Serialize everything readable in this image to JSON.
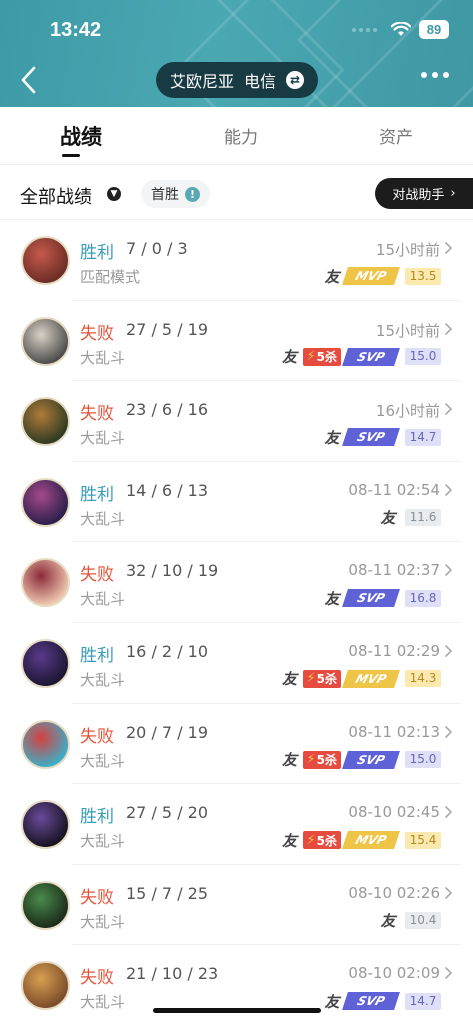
{
  "status_bar": {
    "time": "13:42",
    "battery": "89"
  },
  "header": {
    "server_name": "艾欧尼亚",
    "server_isp": "电信"
  },
  "tabs": [
    {
      "label": "战绩",
      "active": true
    },
    {
      "label": "能力",
      "active": false
    },
    {
      "label": "资产",
      "active": false
    }
  ],
  "filter": {
    "label": "全部战绩",
    "first_win_label": "首胜",
    "assist_label": "对战助手"
  },
  "colors": {
    "win": "#3a9db6",
    "loss": "#e3553a",
    "header": "#4aa8b3"
  },
  "matches": [
    {
      "result": "胜利",
      "outcome": "win",
      "kda": "7 / 0 / 3",
      "mode": "匹配模式",
      "time": "15小时前",
      "friend": true,
      "five_kill": false,
      "award": "mvp",
      "score": "13.5",
      "score_style": "gold",
      "avatar": [
        "#c45a4a",
        "#6b2c25"
      ]
    },
    {
      "result": "失败",
      "outcome": "loss",
      "kda": "27 / 5 / 19",
      "mode": "大乱斗",
      "time": "15小时前",
      "friend": true,
      "five_kill": true,
      "award": "svp",
      "score": "15.0",
      "score_style": "purple",
      "avatar": [
        "#d9d2c5",
        "#4a4a4a"
      ]
    },
    {
      "result": "失败",
      "outcome": "loss",
      "kda": "23 / 6 / 16",
      "mode": "大乱斗",
      "time": "16小时前",
      "friend": true,
      "five_kill": false,
      "award": "svp",
      "score": "14.7",
      "score_style": "purple",
      "avatar": [
        "#b07b3a",
        "#2d3a22"
      ]
    },
    {
      "result": "胜利",
      "outcome": "win",
      "kda": "14 / 6 / 13",
      "mode": "大乱斗",
      "time": "08-11 02:54",
      "friend": true,
      "five_kill": false,
      "award": "",
      "score": "11.6",
      "score_style": "gray",
      "avatar": [
        "#a34a8a",
        "#2a1e4a"
      ]
    },
    {
      "result": "失败",
      "outcome": "loss",
      "kda": "32 / 10 / 19",
      "mode": "大乱斗",
      "time": "08-11 02:37",
      "friend": true,
      "five_kill": false,
      "award": "svp",
      "score": "16.8",
      "score_style": "purple",
      "avatar": [
        "#8a2a3a",
        "#f0c9b0"
      ]
    },
    {
      "result": "胜利",
      "outcome": "win",
      "kda": "16 / 2 / 10",
      "mode": "大乱斗",
      "time": "08-11 02:29",
      "friend": true,
      "five_kill": true,
      "award": "mvp",
      "score": "14.3",
      "score_style": "gold",
      "avatar": [
        "#5a3a8a",
        "#1a1530"
      ]
    },
    {
      "result": "失败",
      "outcome": "loss",
      "kda": "20 / 7 / 19",
      "mode": "大乱斗",
      "time": "08-11 02:13",
      "friend": true,
      "five_kill": true,
      "award": "svp",
      "score": "15.0",
      "score_style": "purple",
      "avatar": [
        "#d64040",
        "#3ab0c8"
      ]
    },
    {
      "result": "胜利",
      "outcome": "win",
      "kda": "27 / 5 / 20",
      "mode": "大乱斗",
      "time": "08-10 02:45",
      "friend": true,
      "five_kill": true,
      "award": "mvp",
      "score": "15.4",
      "score_style": "gold",
      "avatar": [
        "#6a4a9a",
        "#15121f"
      ]
    },
    {
      "result": "失败",
      "outcome": "loss",
      "kda": "15 / 7 / 25",
      "mode": "大乱斗",
      "time": "08-10 02:26",
      "friend": true,
      "five_kill": false,
      "award": "",
      "score": "10.4",
      "score_style": "gray",
      "avatar": [
        "#4a8a4a",
        "#1a2a1a"
      ]
    },
    {
      "result": "失败",
      "outcome": "loss",
      "kda": "21 / 10 / 23",
      "mode": "大乱斗",
      "time": "08-10 02:09",
      "friend": true,
      "five_kill": false,
      "award": "svp",
      "score": "14.7",
      "score_style": "purple",
      "avatar": [
        "#d8a050",
        "#7a4a2a"
      ]
    }
  ],
  "badges": {
    "friend": "友",
    "five_kill": "5杀",
    "mvp": "MVP",
    "svp": "SVP"
  }
}
